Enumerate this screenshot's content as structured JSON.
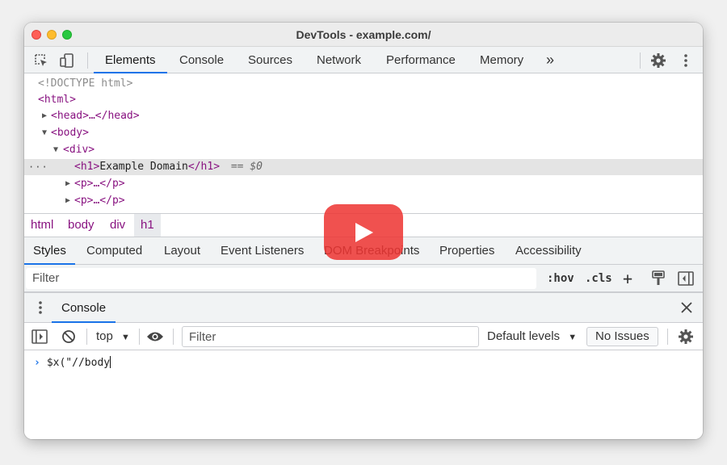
{
  "window": {
    "title": "DevTools - example.com/"
  },
  "main_tabs": [
    {
      "label": "Elements",
      "active": true
    },
    {
      "label": "Console",
      "active": false
    },
    {
      "label": "Sources",
      "active": false
    },
    {
      "label": "Network",
      "active": false
    },
    {
      "label": "Performance",
      "active": false
    },
    {
      "label": "Memory",
      "active": false
    }
  ],
  "more_tabs_label": "»",
  "dom": {
    "doctype": "<!DOCTYPE html>",
    "html_open": "<html>",
    "head_collapsed": "<head>…</head>",
    "body_open": "<body>",
    "div_open": "<div>",
    "h1_open": "<h1>",
    "h1_text": "Example Domain",
    "h1_close": "</h1>",
    "selected_marker": "== $0",
    "p1": "<p>…</p>",
    "p2": "<p>…</p>",
    "row_dots": "···"
  },
  "breadcrumbs": [
    "html",
    "body",
    "div",
    "h1"
  ],
  "sub_tabs": [
    {
      "label": "Styles",
      "active": true
    },
    {
      "label": "Computed",
      "active": false
    },
    {
      "label": "Layout",
      "active": false
    },
    {
      "label": "Event Listeners",
      "active": false
    },
    {
      "label": "DOM Breakpoints",
      "active": false
    },
    {
      "label": "Properties",
      "active": false
    },
    {
      "label": "Accessibility",
      "active": false
    }
  ],
  "styles_toolbar": {
    "filter_placeholder": "Filter",
    "hov": ":hov",
    "cls": ".cls",
    "plus": "+"
  },
  "drawer": {
    "tab": "Console"
  },
  "console_toolbar": {
    "context": "top",
    "filter_placeholder": "Filter",
    "levels": "Default levels",
    "issues": "No Issues"
  },
  "console": {
    "input": "$x(\"//body"
  },
  "colors": {
    "accent": "#1a73e8",
    "tag": "#881280",
    "play_button": "#ee3432"
  }
}
